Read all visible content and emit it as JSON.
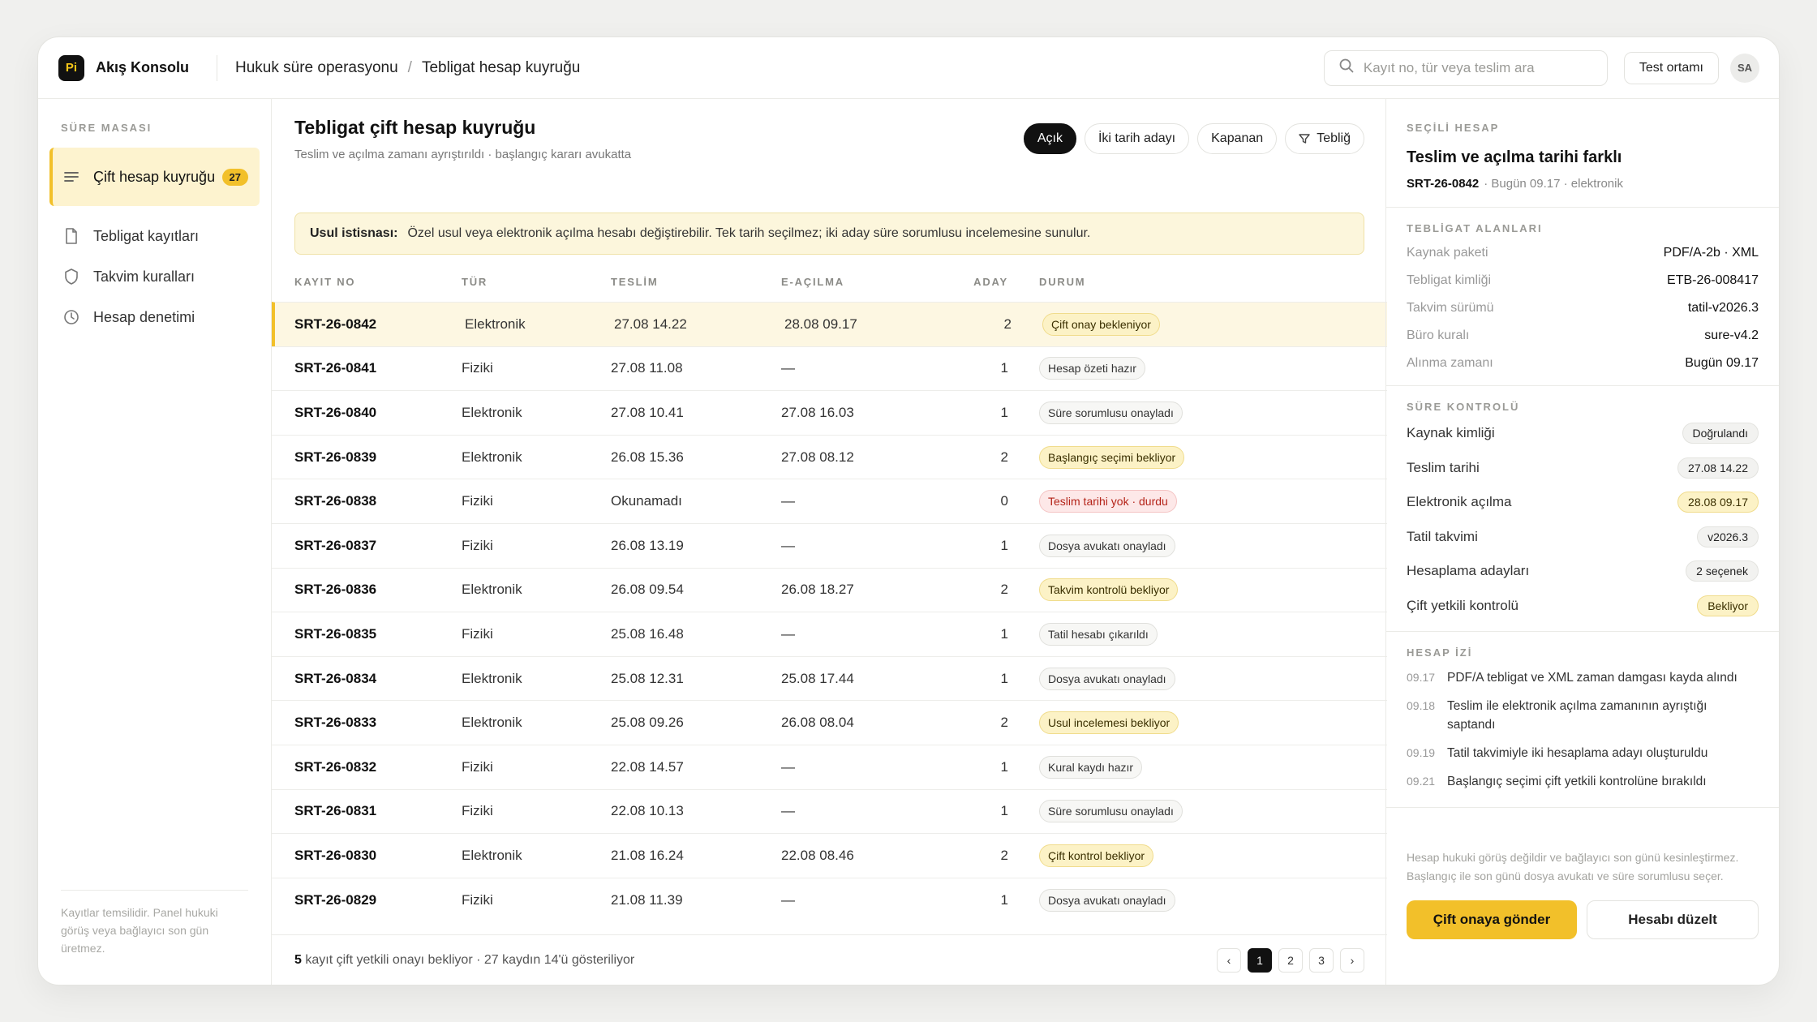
{
  "app": {
    "logo_text": "Pi",
    "name": "Akış Konsolu"
  },
  "breadcrumb": {
    "root": "Hukuk süre operasyonu",
    "separator": "/",
    "current": "Tebligat hesap kuyruğu"
  },
  "search": {
    "placeholder": "Kayıt no, tür veya teslim ara",
    "icon": "search-icon"
  },
  "topbar": {
    "env_label": "Test ortamı",
    "avatar_initials": "SA"
  },
  "sidebar": {
    "heading": "SÜRE MASASI",
    "items": [
      {
        "label": "Çift hesap kuyruğu",
        "count": "27",
        "icon": "list-icon",
        "active": true
      },
      {
        "label": "Tebligat kayıtları",
        "icon": "document-icon"
      },
      {
        "label": "Takvim kuralları",
        "icon": "shield-icon"
      },
      {
        "label": "Hesap denetimi",
        "icon": "clock-icon"
      }
    ],
    "note": "Kayıtlar temsilidir. Panel hukuki görüş veya bağlayıcı son gün üretmez."
  },
  "main": {
    "title": "Tebligat çift hesap kuyruğu",
    "subtitle": "Teslim ve açılma zamanı ayrıştırıldı · başlangıç kararı avukatta",
    "filters": [
      {
        "label": "Açık",
        "active": true
      },
      {
        "label": "İki tarih adayı"
      },
      {
        "label": "Kapanan"
      },
      {
        "label": "Tebliğ",
        "icon": "filter-icon"
      }
    ],
    "notice": {
      "label": "Usul istisnası:",
      "text": "Özel usul veya elektronik açılma hesabı değiştirebilir. Tek tarih seçilmez; iki aday süre sorumlusu incelemesine sunulur."
    },
    "columns": [
      "KAYIT NO",
      "TÜR",
      "TESLİM",
      "E-AÇILMA",
      "ADAY",
      "DURUM"
    ],
    "rows": [
      {
        "id": "SRT-26-0842",
        "type": "Elektronik",
        "delivery": "27.08 14.22",
        "eopen": "28.08 09.17",
        "candidates": "2",
        "status": "Çift onay bekleniyor",
        "tone": "wait",
        "selected": true
      },
      {
        "id": "SRT-26-0841",
        "type": "Fiziki",
        "delivery": "27.08 11.08",
        "eopen": "—",
        "candidates": "1",
        "status": "Hesap özeti hazır",
        "tone": "neutral"
      },
      {
        "id": "SRT-26-0840",
        "type": "Elektronik",
        "delivery": "27.08 10.41",
        "eopen": "27.08 16.03",
        "candidates": "1",
        "status": "Süre sorumlusu onayladı",
        "tone": "neutral"
      },
      {
        "id": "SRT-26-0839",
        "type": "Elektronik",
        "delivery": "26.08 15.36",
        "eopen": "27.08 08.12",
        "candidates": "2",
        "status": "Başlangıç seçimi bekliyor",
        "tone": "wait"
      },
      {
        "id": "SRT-26-0838",
        "type": "Fiziki",
        "delivery": "Okunamadı",
        "eopen": "—",
        "candidates": "0",
        "status": "Teslim tarihi yok · durdu",
        "tone": "error"
      },
      {
        "id": "SRT-26-0837",
        "type": "Fiziki",
        "delivery": "26.08 13.19",
        "eopen": "—",
        "candidates": "1",
        "status": "Dosya avukatı onayladı",
        "tone": "neutral"
      },
      {
        "id": "SRT-26-0836",
        "type": "Elektronik",
        "delivery": "26.08 09.54",
        "eopen": "26.08 18.27",
        "candidates": "2",
        "status": "Takvim kontrolü bekliyor",
        "tone": "wait"
      },
      {
        "id": "SRT-26-0835",
        "type": "Fiziki",
        "delivery": "25.08 16.48",
        "eopen": "—",
        "candidates": "1",
        "status": "Tatil hesabı çıkarıldı",
        "tone": "neutral"
      },
      {
        "id": "SRT-26-0834",
        "type": "Elektronik",
        "delivery": "25.08 12.31",
        "eopen": "25.08 17.44",
        "candidates": "1",
        "status": "Dosya avukatı onayladı",
        "tone": "neutral"
      },
      {
        "id": "SRT-26-0833",
        "type": "Elektronik",
        "delivery": "25.08 09.26",
        "eopen": "26.08 08.04",
        "candidates": "2",
        "status": "Usul incelemesi bekliyor",
        "tone": "wait"
      },
      {
        "id": "SRT-26-0832",
        "type": "Fiziki",
        "delivery": "22.08 14.57",
        "eopen": "—",
        "candidates": "1",
        "status": "Kural kaydı hazır",
        "tone": "neutral"
      },
      {
        "id": "SRT-26-0831",
        "type": "Fiziki",
        "delivery": "22.08 10.13",
        "eopen": "—",
        "candidates": "1",
        "status": "Süre sorumlusu onayladı",
        "tone": "neutral"
      },
      {
        "id": "SRT-26-0830",
        "type": "Elektronik",
        "delivery": "21.08 16.24",
        "eopen": "22.08 08.46",
        "candidates": "2",
        "status": "Çift kontrol bekliyor",
        "tone": "wait"
      },
      {
        "id": "SRT-26-0829",
        "type": "Fiziki",
        "delivery": "21.08 11.39",
        "eopen": "—",
        "candidates": "1",
        "status": "Dosya avukatı onayladı",
        "tone": "neutral"
      }
    ],
    "footer": {
      "count": "5",
      "text": " kayıt çift yetkili onayı bekliyor · 27 kaydın 14'ü gösteriliyor"
    },
    "pagination": {
      "prev": "‹",
      "pages": [
        "1",
        "2",
        "3"
      ],
      "current": "1",
      "next": "›"
    }
  },
  "panel": {
    "heading": "SEÇİLİ HESAP",
    "title": "Teslim ve açılma tarihi farklı",
    "record_id": "SRT-26-0842",
    "meta": "· Bugün 09.17 · elektronik",
    "fields_heading": "TEBLİGAT ALANLARI",
    "fields": [
      {
        "k": "Kaynak paketi",
        "v": "PDF/A-2b · XML"
      },
      {
        "k": "Tebligat kimliği",
        "v": "ETB-26-008417"
      },
      {
        "k": "Takvim sürümü",
        "v": "tatil-v2026.3"
      },
      {
        "k": "Büro kuralı",
        "v": "sure-v4.2"
      },
      {
        "k": "Alınma zamanı",
        "v": "Bugün 09.17"
      }
    ],
    "checks_heading": "SÜRE KONTROLÜ",
    "checks": [
      {
        "k": "Kaynak kimliği",
        "v": "Doğrulandı",
        "tone": "neutral"
      },
      {
        "k": "Teslim tarihi",
        "v": "27.08 14.22",
        "tone": "neutral"
      },
      {
        "k": "Elektronik açılma",
        "v": "28.08 09.17",
        "tone": "wait"
      },
      {
        "k": "Tatil takvimi",
        "v": "v2026.3",
        "tone": "neutral"
      },
      {
        "k": "Hesaplama adayları",
        "v": "2 seçenek",
        "tone": "neutral"
      },
      {
        "k": "Çift yetkili kontrolü",
        "v": "Bekliyor",
        "tone": "wait"
      }
    ],
    "trail_heading": "HESAP İZİ",
    "trail": [
      {
        "t": "09.17",
        "text": "PDF/A tebligat ve XML zaman damgası kayda alındı"
      },
      {
        "t": "09.18",
        "text": "Teslim ile elektronik açılma zamanının ayrıştığı saptandı"
      },
      {
        "t": "09.19",
        "text": "Tatil takvimiyle iki hesaplama adayı oluşturuldu"
      },
      {
        "t": "09.21",
        "text": "Başlangıç seçimi çift yetkili kontrolüne bırakıldı"
      }
    ],
    "note": "Hesap hukuki görüş değildir ve bağlayıcı son günü kesinleştirmez. Başlangıç ile son günü dosya avukatı ve süre sorumlusu seçer.",
    "primary_action": "Çift onaya gönder",
    "secondary_action": "Hesabı düzelt"
  },
  "colors": {
    "accent": "#f2c02a",
    "accent_soft": "#fcf2c6",
    "error": "#b42318",
    "dark": "#111111"
  }
}
